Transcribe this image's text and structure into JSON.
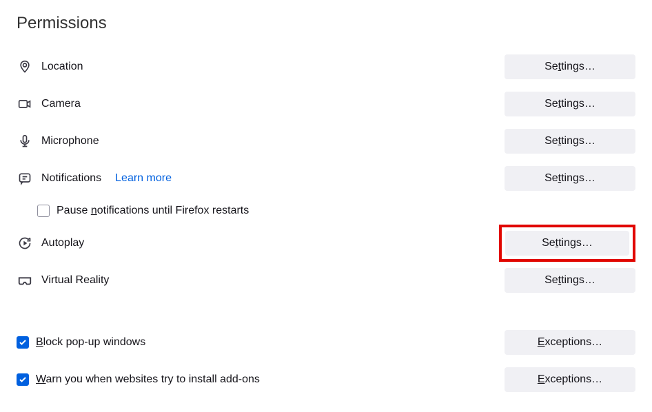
{
  "section": {
    "title": "Permissions"
  },
  "rows": {
    "location": {
      "label": "Location",
      "button_prefix": "Se",
      "button_ak": "t",
      "button_suffix": "tings…"
    },
    "camera": {
      "label": "Camera",
      "button_prefix": "Se",
      "button_ak": "t",
      "button_suffix": "tings…"
    },
    "microphone": {
      "label": "Microphone",
      "button_prefix": "Se",
      "button_ak": "t",
      "button_suffix": "tings…"
    },
    "notifications": {
      "label": "Notifications",
      "learn_more": "Learn more",
      "button_prefix": "Se",
      "button_ak": "t",
      "button_suffix": "tings…",
      "pause_prefix": "Pause ",
      "pause_ak": "n",
      "pause_suffix": "otifications until Firefox restarts",
      "pause_checked": false
    },
    "autoplay": {
      "label": "Autoplay",
      "button_prefix": "Se",
      "button_ak": "t",
      "button_suffix": "tings…",
      "highlighted": true
    },
    "vr": {
      "label": "Virtual Reality",
      "button_prefix": "Se",
      "button_ak": "t",
      "button_suffix": "tings…"
    },
    "popup": {
      "label_ak": "B",
      "label_rest": "lock pop-up windows",
      "button_ak": "E",
      "button_rest": "xceptions…",
      "checked": true
    },
    "warn_addons": {
      "label_ak": "W",
      "label_rest": "arn you when websites try to install add-ons",
      "button_ak": "E",
      "button_rest": "xceptions…",
      "checked": true
    }
  }
}
